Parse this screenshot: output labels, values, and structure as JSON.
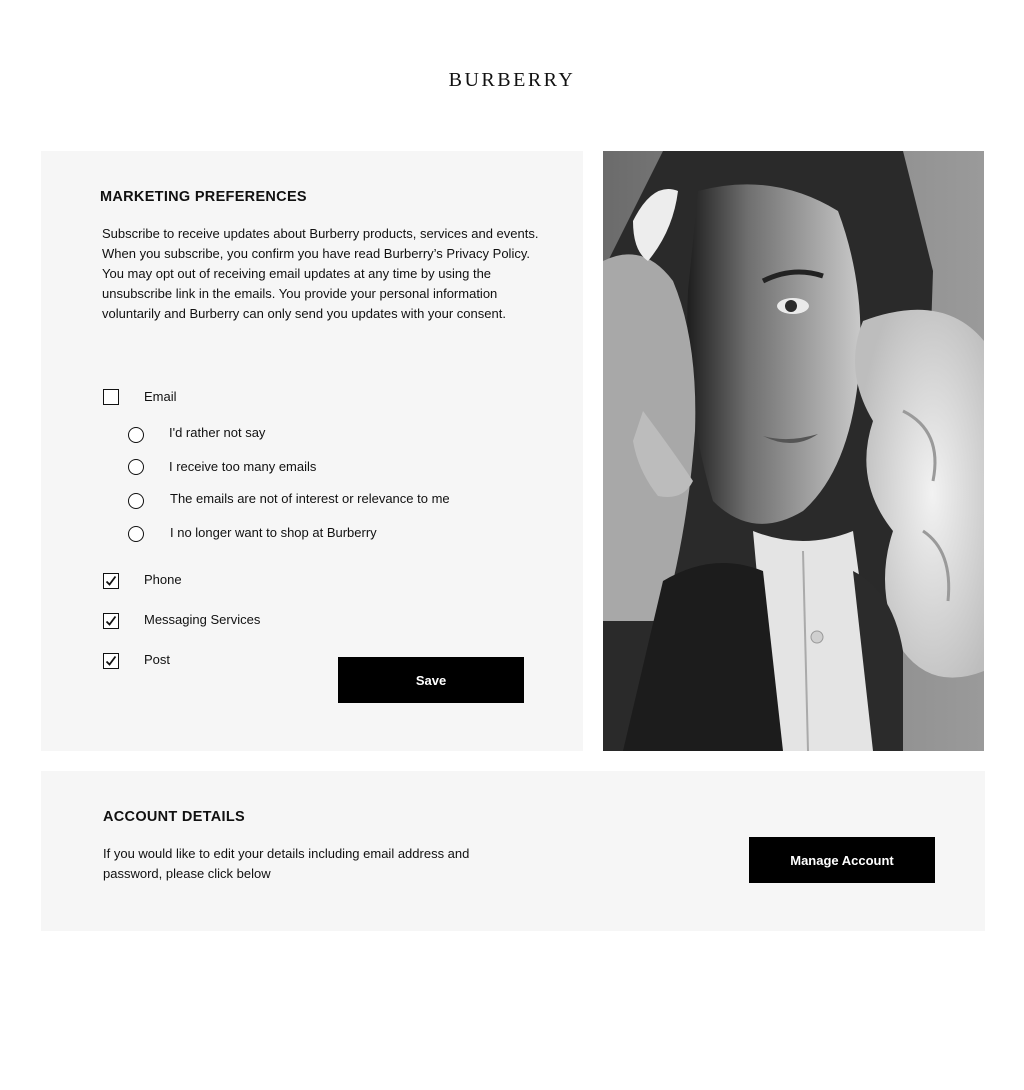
{
  "brand": {
    "logo_text": "BURBERRY"
  },
  "marketing": {
    "title": "MARKETING PREFERENCES",
    "body": "Subscribe to receive updates about Burberry products, services and events. When you subscribe, you confirm you have read Burberry’s Privacy Policy. You may opt out of receiving email updates at any time by using the unsubscribe link in the emails. You provide your personal information voluntarily and Burberry can only send you updates with your consent.",
    "channels": {
      "email": {
        "label": "Email",
        "checked": false
      },
      "phone": {
        "label": "Phone",
        "checked": true
      },
      "messaging": {
        "label": "Messaging Services",
        "checked": true
      },
      "post": {
        "label": "Post",
        "checked": true
      }
    },
    "reasons": [
      {
        "label": "I'd rather not say",
        "selected": false
      },
      {
        "label": "I receive too many emails",
        "selected": false
      },
      {
        "label": "The emails are not of interest or relevance to me",
        "selected": false
      },
      {
        "label": "I no longer want to shop at Burberry",
        "selected": false
      }
    ],
    "save_label": "Save"
  },
  "account": {
    "title": "ACCOUNT DETAILS",
    "body": "If you would like to edit your details including email address and password, please click below",
    "manage_label": "Manage Account"
  },
  "colors": {
    "panel_bg": "#f6f6f6",
    "button_bg": "#000000",
    "button_text": "#ffffff"
  }
}
